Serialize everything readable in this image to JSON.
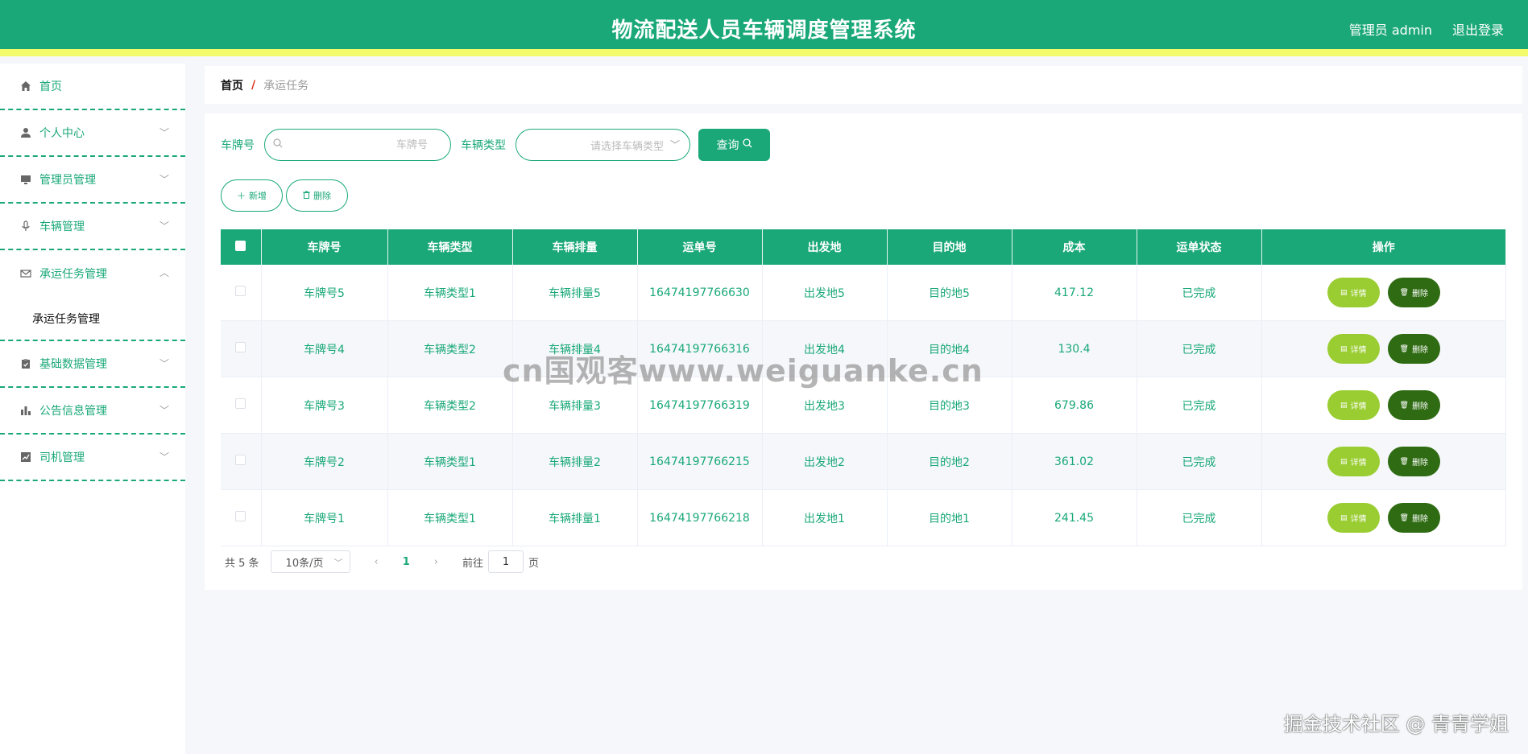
{
  "header": {
    "title": "物流配送人员车辆调度管理系统",
    "admin_label": "管理员 admin",
    "logout_label": "退出登录"
  },
  "sidebar": {
    "items": [
      {
        "label": "首页",
        "icon": "home-icon"
      },
      {
        "label": "个人中心",
        "icon": "user-icon"
      },
      {
        "label": "管理员管理",
        "icon": "monitor-icon"
      },
      {
        "label": "车辆管理",
        "icon": "microphone-icon"
      },
      {
        "label": "承运任务管理",
        "icon": "mail-icon"
      },
      {
        "label": "基础数据管理",
        "icon": "clipboard-icon"
      },
      {
        "label": "公告信息管理",
        "icon": "bar-chart-icon"
      },
      {
        "label": "司机管理",
        "icon": "line-chart-icon"
      }
    ],
    "submenu": {
      "label": "承运任务管理"
    }
  },
  "breadcrumb": {
    "home": "首页",
    "separator": "/",
    "current": "承运任务"
  },
  "search": {
    "plate_label": "车牌号",
    "plate_placeholder": "车牌号",
    "type_label": "车辆类型",
    "type_placeholder": "请选择车辆类型",
    "query_label": "查询"
  },
  "actions": {
    "add_label": "新增",
    "delete_label": "删除"
  },
  "table": {
    "columns": [
      "车牌号",
      "车辆类型",
      "车辆排量",
      "运单号",
      "出发地",
      "目的地",
      "成本",
      "运单状态",
      "操作"
    ],
    "rows": [
      {
        "plate": "车牌号5",
        "type": "车辆类型1",
        "displacement": "车辆排量5",
        "waybill": "16474197766630",
        "origin": "出发地5",
        "destination": "目的地5",
        "cost": "417.12",
        "status": "已完成"
      },
      {
        "plate": "车牌号4",
        "type": "车辆类型2",
        "displacement": "车辆排量4",
        "waybill": "16474197766316",
        "origin": "出发地4",
        "destination": "目的地4",
        "cost": "130.4",
        "status": "已完成"
      },
      {
        "plate": "车牌号3",
        "type": "车辆类型2",
        "displacement": "车辆排量3",
        "waybill": "16474197766319",
        "origin": "出发地3",
        "destination": "目的地3",
        "cost": "679.86",
        "status": "已完成"
      },
      {
        "plate": "车牌号2",
        "type": "车辆类型1",
        "displacement": "车辆排量2",
        "waybill": "16474197766215",
        "origin": "出发地2",
        "destination": "目的地2",
        "cost": "361.02",
        "status": "已完成"
      },
      {
        "plate": "车牌号1",
        "type": "车辆类型1",
        "displacement": "车辆排量1",
        "waybill": "16474197766218",
        "origin": "出发地1",
        "destination": "目的地1",
        "cost": "241.45",
        "status": "已完成"
      }
    ],
    "detail_label": "详情",
    "delete_label": "删除"
  },
  "pagination": {
    "total": "共 5 条",
    "page_size": "10条/页",
    "current_page": "1",
    "goto_label": "前往",
    "goto_value": "1",
    "page_suffix": "页"
  },
  "watermark": "cn国观客www.weiguanke.cn",
  "footer_mark": "掘金技术社区 @ 青青学姐",
  "colors": {
    "primary": "#1aa879",
    "accent_stripe": "#f4fb6b",
    "detail_button": "#9acd32",
    "delete_button": "#2e6b12"
  }
}
